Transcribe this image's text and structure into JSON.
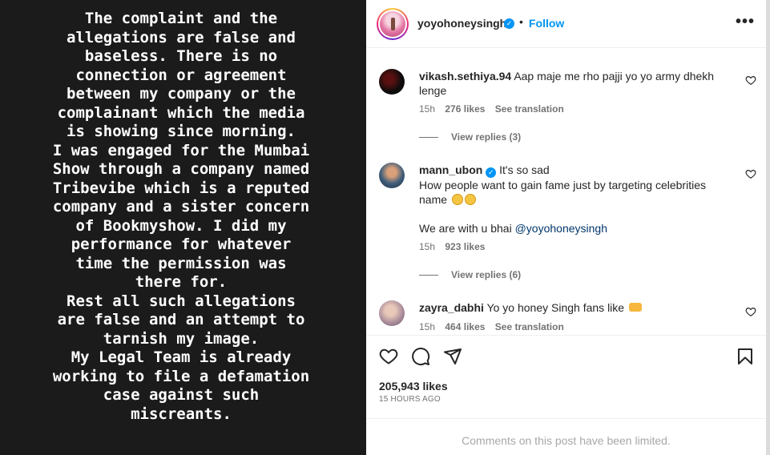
{
  "story": {
    "lines": [
      "The complaint and the",
      "allegations are false and",
      "baseless. There is no",
      "connection or agreement",
      "between my company or the",
      "complainant which the media",
      "is showing since morning.",
      "I was engaged for the Mumbai",
      "Show through a company named",
      "Tribevibe which is a reputed",
      "company and a sister concern",
      "of Bookmyshow. I did my",
      "performance for whatever",
      "time the permission was",
      "there for.",
      "Rest all such allegations",
      "are false and an attempt to",
      "tarnish my image.",
      "My Legal Team is already",
      "working to file a defamation",
      "case against such",
      "miscreants."
    ]
  },
  "header": {
    "username": "yoyohoneysingh",
    "separator": "•",
    "follow_label": "Follow",
    "more_label": "•••"
  },
  "comments": [
    {
      "username": "vikash.sethiya.94",
      "text": "Aap maje me rho pajji yo yo army dhekh lenge",
      "time": "15h",
      "likes": "276 likes",
      "translate": "See translation",
      "replies": "View replies (3)"
    },
    {
      "username": "mann_ubon",
      "text_line1": "It's so sad",
      "text_line2": "How people want to gain fame just by targeting celebrities name",
      "text_line3_prefix": "We are with u bhai",
      "mention": "@yoyohoneysingh",
      "time": "15h",
      "likes": "923 likes",
      "replies": "View replies (6)"
    },
    {
      "username": "zayra_dabhi",
      "text": "Yo yo honey Singh fans like",
      "time": "15h",
      "likes": "464 likes",
      "translate": "See translation"
    }
  ],
  "post": {
    "likes": "205,943 likes",
    "time_ago": "15 HOURS AGO",
    "comments_limited": "Comments on this post have been limited."
  }
}
